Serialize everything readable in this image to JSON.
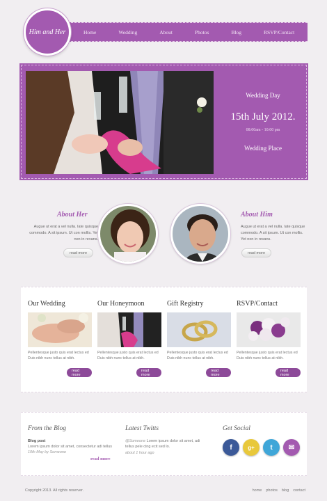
{
  "logo": {
    "text": "Him and Her"
  },
  "nav": [
    "Home",
    "Wedding",
    "About",
    "Photos",
    "Blog",
    "RSVP/Contact"
  ],
  "hero": {
    "title": "Wedding Day",
    "date": "15th July 2012.",
    "time": "08:00am - 10:00 pm",
    "place": "Wedding Place"
  },
  "about": {
    "her": {
      "heading": "About Her",
      "text": "Augue ut erat a vel nulla. Iate quisque commodo. A sit ipsum. Ut con mollis. Yet non in revans.",
      "button": "read more"
    },
    "him": {
      "heading": "About Him",
      "text": "Augue ut erat a vel nulla. Iate quisque commodo. A sit ipsum. Ut con mollis. Yet non in revans.",
      "button": "read more"
    }
  },
  "features": [
    {
      "heading": "Our Wedding",
      "text": "Pellentesque justo quis erat lectus ed Duis nibh nunc tellus at nibh.",
      "button": "read more"
    },
    {
      "heading": "Our Honeymoon",
      "text": "Pellentesque justo quis erat lectus ed Duis nibh nunc tellus at nibh.",
      "button": "read more"
    },
    {
      "heading": "Gift Registry",
      "text": "Pellentesque justo quis erat lectus ed Duis nibh nunc tellus at nibh.",
      "button": "read more"
    },
    {
      "heading": "RSVP/Contact",
      "text": "Pellentesque justo quis erat lectus ed Duis nibh nunc tellus at nibh.",
      "button": "read more"
    }
  ],
  "blog": {
    "heading": "From the Blog",
    "post_title": "Blog post",
    "post_text": "Lorem ipsum dolor sit amet, consectetur adi tellus",
    "post_meta": "10th May by Someone",
    "button": "read more"
  },
  "twitts": {
    "heading": "Latest Twitts",
    "handle": "@Someone",
    "text": "Lorem ipsum dolor sit amet, adi tellus pele cing ecit sed lo.",
    "meta": "about 1 hour ago"
  },
  "social": {
    "heading": "Get Social",
    "icons": [
      {
        "name": "facebook-icon",
        "glyph": "f",
        "color": "#3b5998"
      },
      {
        "name": "google-plus-icon",
        "glyph": "g+",
        "color": "#e8c83b"
      },
      {
        "name": "twitter-icon",
        "glyph": "t",
        "color": "#3fa6d8"
      },
      {
        "name": "email-icon",
        "glyph": "✉",
        "color": "#a35ab0"
      }
    ]
  },
  "footer": {
    "copyright": "Copyright 2013. All rights reserver.",
    "links": [
      "home",
      "photos",
      "blog",
      "contact"
    ]
  }
}
